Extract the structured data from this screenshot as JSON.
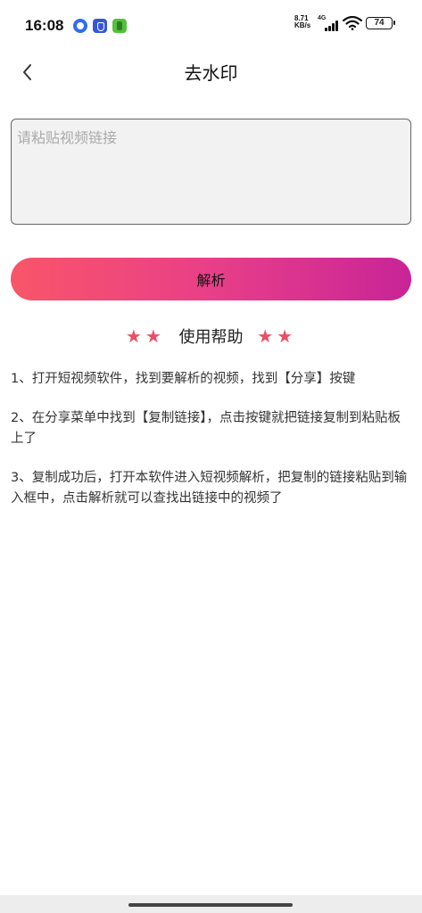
{
  "status_bar": {
    "time": "16:08",
    "net_speed_value": "8.71",
    "net_speed_unit": "KB/s",
    "network_type": "4G",
    "battery": "74",
    "notification_icons": [
      "browser-icon",
      "shield-app-icon",
      "green-app-icon"
    ]
  },
  "header": {
    "title": "去水印",
    "back_icon": "chevron-left-icon"
  },
  "input": {
    "placeholder": "请粘贴视频链接",
    "value": ""
  },
  "parse_button": {
    "label": "解析"
  },
  "help": {
    "stars_left": "★★",
    "stars_right": "★★",
    "title": "使用帮助",
    "steps": [
      "1、打开短视频软件，找到要解析的视频，找到【分享】按键",
      "2、在分享菜单中找到【复制链接】，点击按键就把链接复制到粘贴板上了",
      "3、复制成功后，打开本软件进入短视频解析，把复制的链接粘贴到输入框中，点击解析就可以查找出链接中的视频了"
    ]
  },
  "colors": {
    "button_gradient_start": "#f95569",
    "button_gradient_end": "#c82497",
    "star": "#ea4e63",
    "input_background": "#f2f2f2"
  }
}
